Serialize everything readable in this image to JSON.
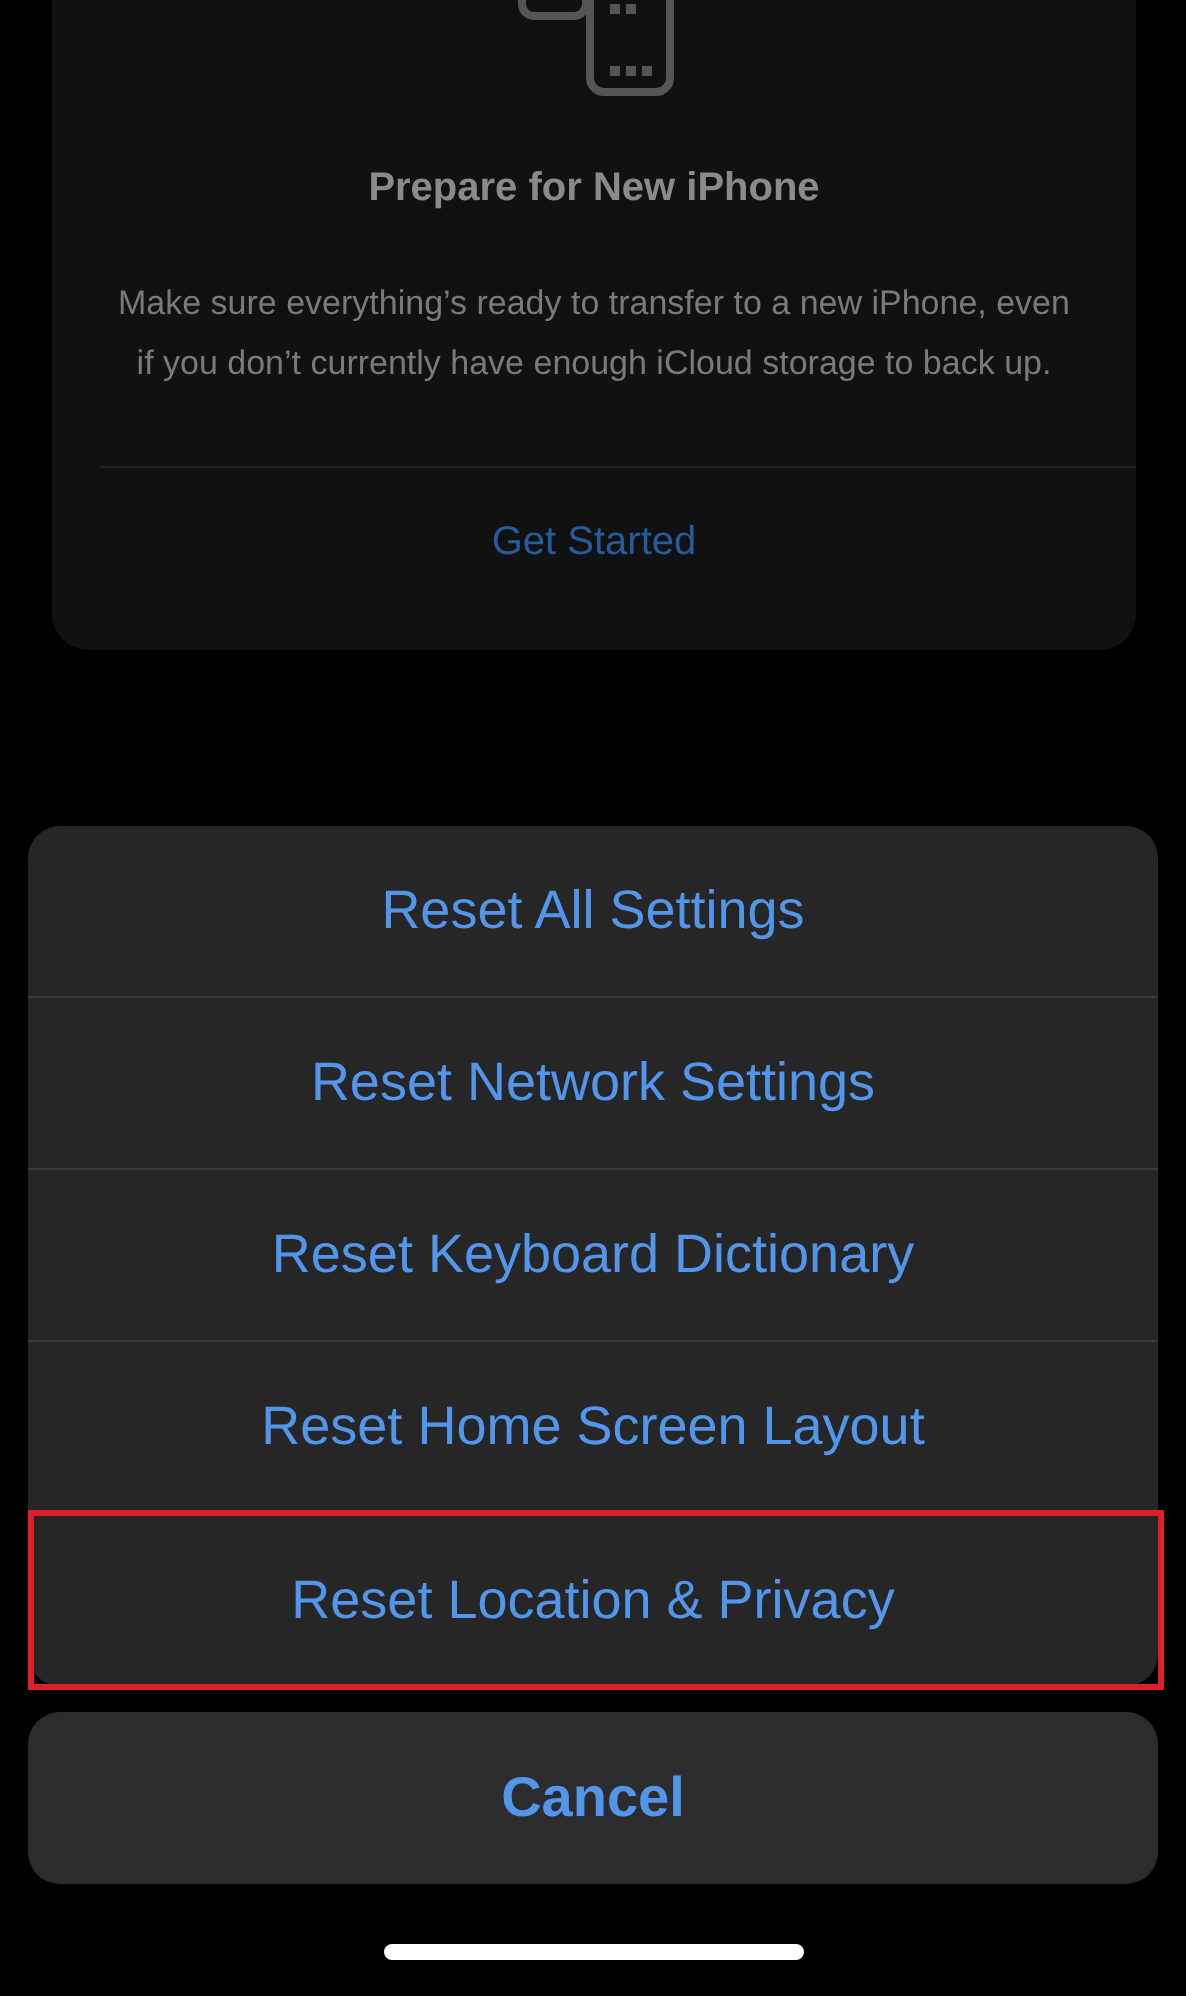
{
  "card": {
    "title": "Prepare for New iPhone",
    "description": "Make sure everything’s ready to transfer to a new iPhone, even if you don’t currently have enough iCloud storage to back up.",
    "action": "Get Started"
  },
  "action_sheet": {
    "items": [
      {
        "label": "Reset All Settings",
        "highlighted": false
      },
      {
        "label": "Reset Network Settings",
        "highlighted": false
      },
      {
        "label": "Reset Keyboard Dictionary",
        "highlighted": false
      },
      {
        "label": "Reset Home Screen Layout",
        "highlighted": false
      },
      {
        "label": "Reset Location & Privacy",
        "highlighted": true
      }
    ],
    "cancel": "Cancel"
  }
}
